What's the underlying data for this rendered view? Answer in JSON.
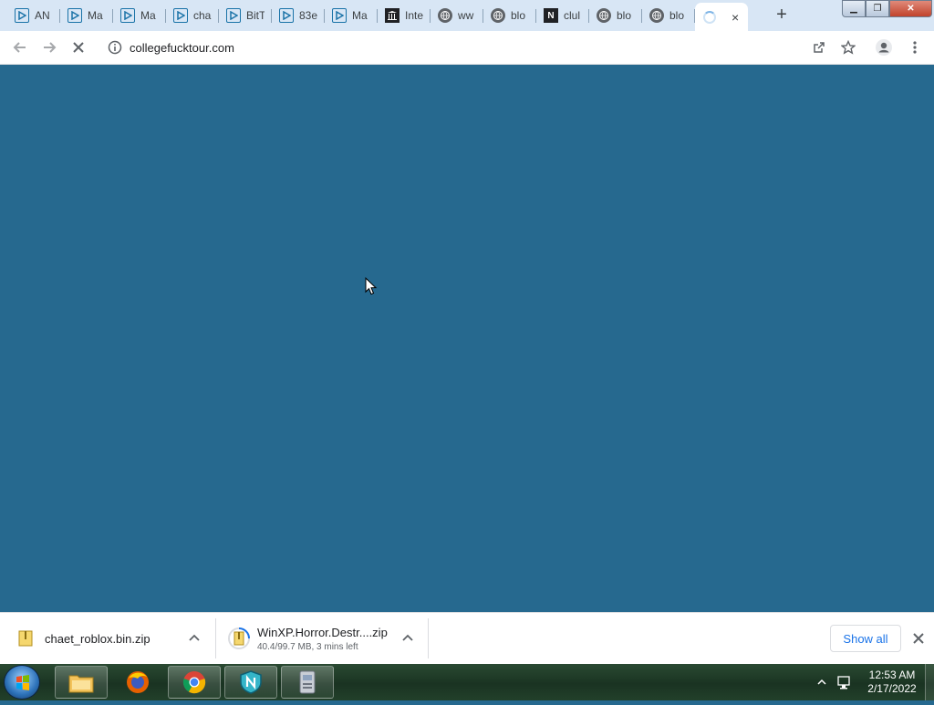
{
  "browser": {
    "tabs": [
      {
        "title": "AN",
        "icon": "play-icon"
      },
      {
        "title": "Ma",
        "icon": "play-icon"
      },
      {
        "title": "Ma",
        "icon": "play-icon"
      },
      {
        "title": "cha",
        "icon": "play-icon"
      },
      {
        "title": "BitT",
        "icon": "play-icon"
      },
      {
        "title": "83e",
        "icon": "play-icon"
      },
      {
        "title": "Ma",
        "icon": "play-icon"
      },
      {
        "title": "Inte",
        "icon": "archive-icon"
      },
      {
        "title": "ww",
        "icon": "globe-icon"
      },
      {
        "title": "blo",
        "icon": "globe-icon"
      },
      {
        "title": "clul",
        "icon": "n-logo-icon"
      },
      {
        "title": "blo",
        "icon": "globe-icon"
      },
      {
        "title": "blo",
        "icon": "globe-icon"
      }
    ],
    "active_tab": {
      "title": "",
      "icon": "loading-spinner-icon",
      "close_label": "×"
    },
    "new_tab_label": "+",
    "url": "collegefucktour.com",
    "window_controls": {
      "minimize": "▁",
      "restore": "❐",
      "close": "✕"
    }
  },
  "downloads": {
    "items": [
      {
        "name": "chaet_roblox.bin.zip",
        "status": ""
      },
      {
        "name": "WinXP.Horror.Destr....zip",
        "status": "40.4/99.7 MB, 3 mins left"
      }
    ],
    "show_all_label": "Show all",
    "close_label": "✕"
  },
  "taskbar": {
    "clock_time": "12:53 AM",
    "clock_date": "2/17/2022"
  },
  "colors": {
    "page_background": "#26698f",
    "tabstrip": "#d8e6f5"
  }
}
